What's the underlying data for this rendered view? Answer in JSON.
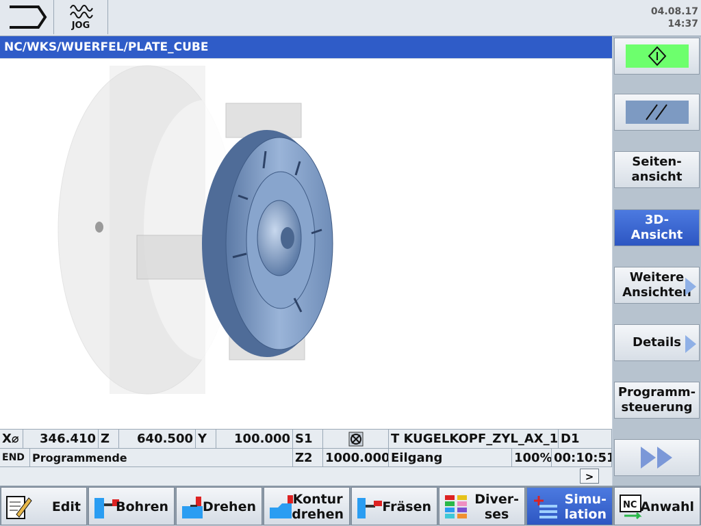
{
  "header": {
    "mode_label": "JOG",
    "date": "04.08.17",
    "time": "14:37"
  },
  "path": "NC/WKS/WUERFEL/PLATE_CUBE",
  "right_softkeys": [
    {
      "label": "",
      "icon": "cycle-start-icon"
    },
    {
      "label": "",
      "icon": "reset-icon"
    },
    {
      "label": "Seiten-\nansicht"
    },
    {
      "label": "3D-\nAnsicht",
      "active": true
    },
    {
      "label": "Weitere\nAnsichten"
    },
    {
      "label": "Details"
    },
    {
      "label": "Programm-\nsteuerung"
    },
    {
      "label": "",
      "icon": "fast-forward-icon"
    }
  ],
  "status": {
    "x_label": "X⌀",
    "x_value": "346.410",
    "z_label": "Z",
    "z_value": "640.500",
    "y_label": "Y",
    "y_value": "100.000",
    "s1_label": "S1",
    "tool": "T KUGELKOPF_ZYL_AX_1",
    "d_label": "D1",
    "end_label": "END",
    "program_state": "Programmende",
    "z2_label": "Z2",
    "z2_value": "1000.000",
    "feed_mode": "Eilgang",
    "override": "100%",
    "runtime": "00:10:51"
  },
  "more_button": ">",
  "bottom_softkeys": [
    {
      "label": "Edit"
    },
    {
      "label": "Bohren"
    },
    {
      "label": "Drehen"
    },
    {
      "label": "Kontur\ndrehen"
    },
    {
      "label": "Fräsen"
    },
    {
      "label": "Diver-\nses"
    },
    {
      "label": "Simu-\nlation",
      "active": true
    },
    {
      "label": "Anwahl"
    }
  ],
  "colors": {
    "accent": "#2f5cc8",
    "cycle_start": "#6dff6d",
    "part": "#7f9ec8"
  }
}
